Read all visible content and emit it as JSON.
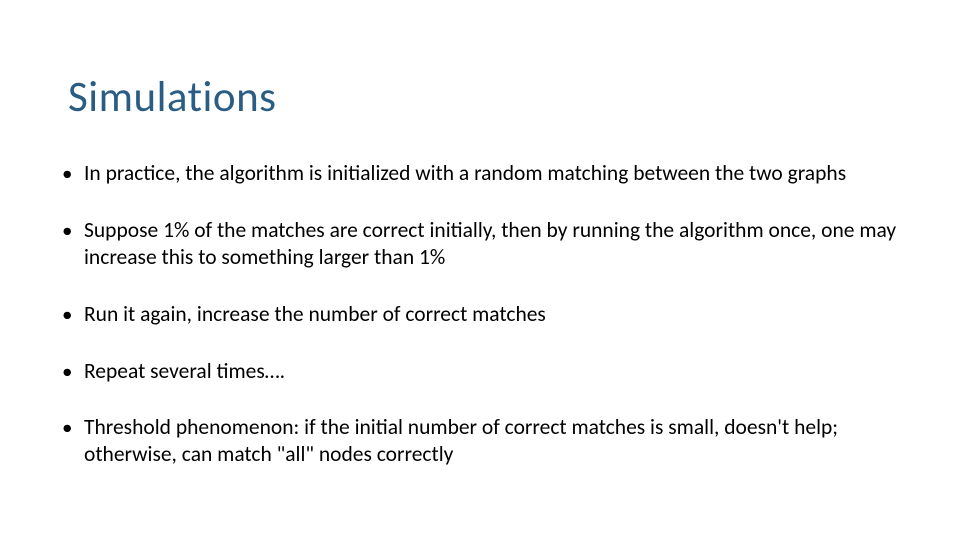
{
  "slide": {
    "title": "Simulations",
    "bullets": [
      "In practice, the algorithm is initialized with a random matching between the two graphs",
      "Suppose 1% of the matches are correct initially, then by running the algorithm once, one may increase this to something larger than 1%",
      "Run it again, increase the number of correct matches",
      "Repeat several times….",
      "Threshold phenomenon: if the initial number of correct matches is small, doesn't help; otherwise, can match \"all\" nodes correctly"
    ]
  }
}
